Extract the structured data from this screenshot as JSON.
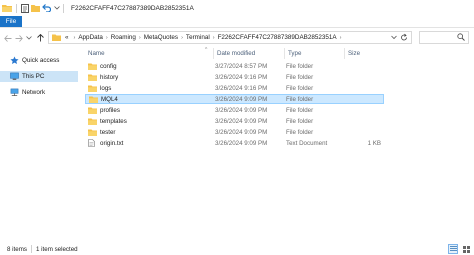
{
  "window": {
    "title": "F2262CFAFF47C27887389DAB2852351A"
  },
  "ribbon": {
    "file_tab": "File"
  },
  "address_bar": {
    "overflow": "«",
    "crumbs": [
      "AppData",
      "Roaming",
      "MetaQuotes",
      "Terminal",
      "F2262CFAFF47C27887389DAB2852351A"
    ]
  },
  "nav_pane": {
    "items": [
      {
        "label": "Quick access",
        "icon": "star-icon",
        "selected": false
      },
      {
        "label": "This PC",
        "icon": "computer-icon",
        "selected": true
      },
      {
        "label": "Network",
        "icon": "network-icon",
        "selected": false
      }
    ]
  },
  "columns": {
    "name": "Name",
    "date_modified": "Date modified",
    "type": "Type",
    "size": "Size"
  },
  "files": [
    {
      "name": "config",
      "date": "3/27/2024 8:57 PM",
      "type": "File folder",
      "size": "",
      "icon": "folder-icon",
      "selected": false
    },
    {
      "name": "history",
      "date": "3/26/2024 9:16 PM",
      "type": "File folder",
      "size": "",
      "icon": "folder-icon",
      "selected": false
    },
    {
      "name": "logs",
      "date": "3/26/2024 9:16 PM",
      "type": "File folder",
      "size": "",
      "icon": "folder-icon",
      "selected": false
    },
    {
      "name": "MQL4",
      "date": "3/26/2024 9:09 PM",
      "type": "File folder",
      "size": "",
      "icon": "folder-icon",
      "selected": true
    },
    {
      "name": "profiles",
      "date": "3/26/2024 9:09 PM",
      "type": "File folder",
      "size": "",
      "icon": "folder-icon",
      "selected": false
    },
    {
      "name": "templates",
      "date": "3/26/2024 9:09 PM",
      "type": "File folder",
      "size": "",
      "icon": "folder-icon",
      "selected": false
    },
    {
      "name": "tester",
      "date": "3/26/2024 9:09 PM",
      "type": "File folder",
      "size": "",
      "icon": "folder-icon",
      "selected": false
    },
    {
      "name": "origin.txt",
      "date": "3/26/2024 9:09 PM",
      "type": "Text Document",
      "size": "1 KB",
      "icon": "text-file-icon",
      "selected": false
    }
  ],
  "status": {
    "count": "8 items",
    "selected": "1 item selected"
  },
  "colors": {
    "accent": "#1a73c8",
    "selection": "#cce8ff",
    "selection_border": "#99d1ff",
    "folder": "#f5c24a"
  }
}
